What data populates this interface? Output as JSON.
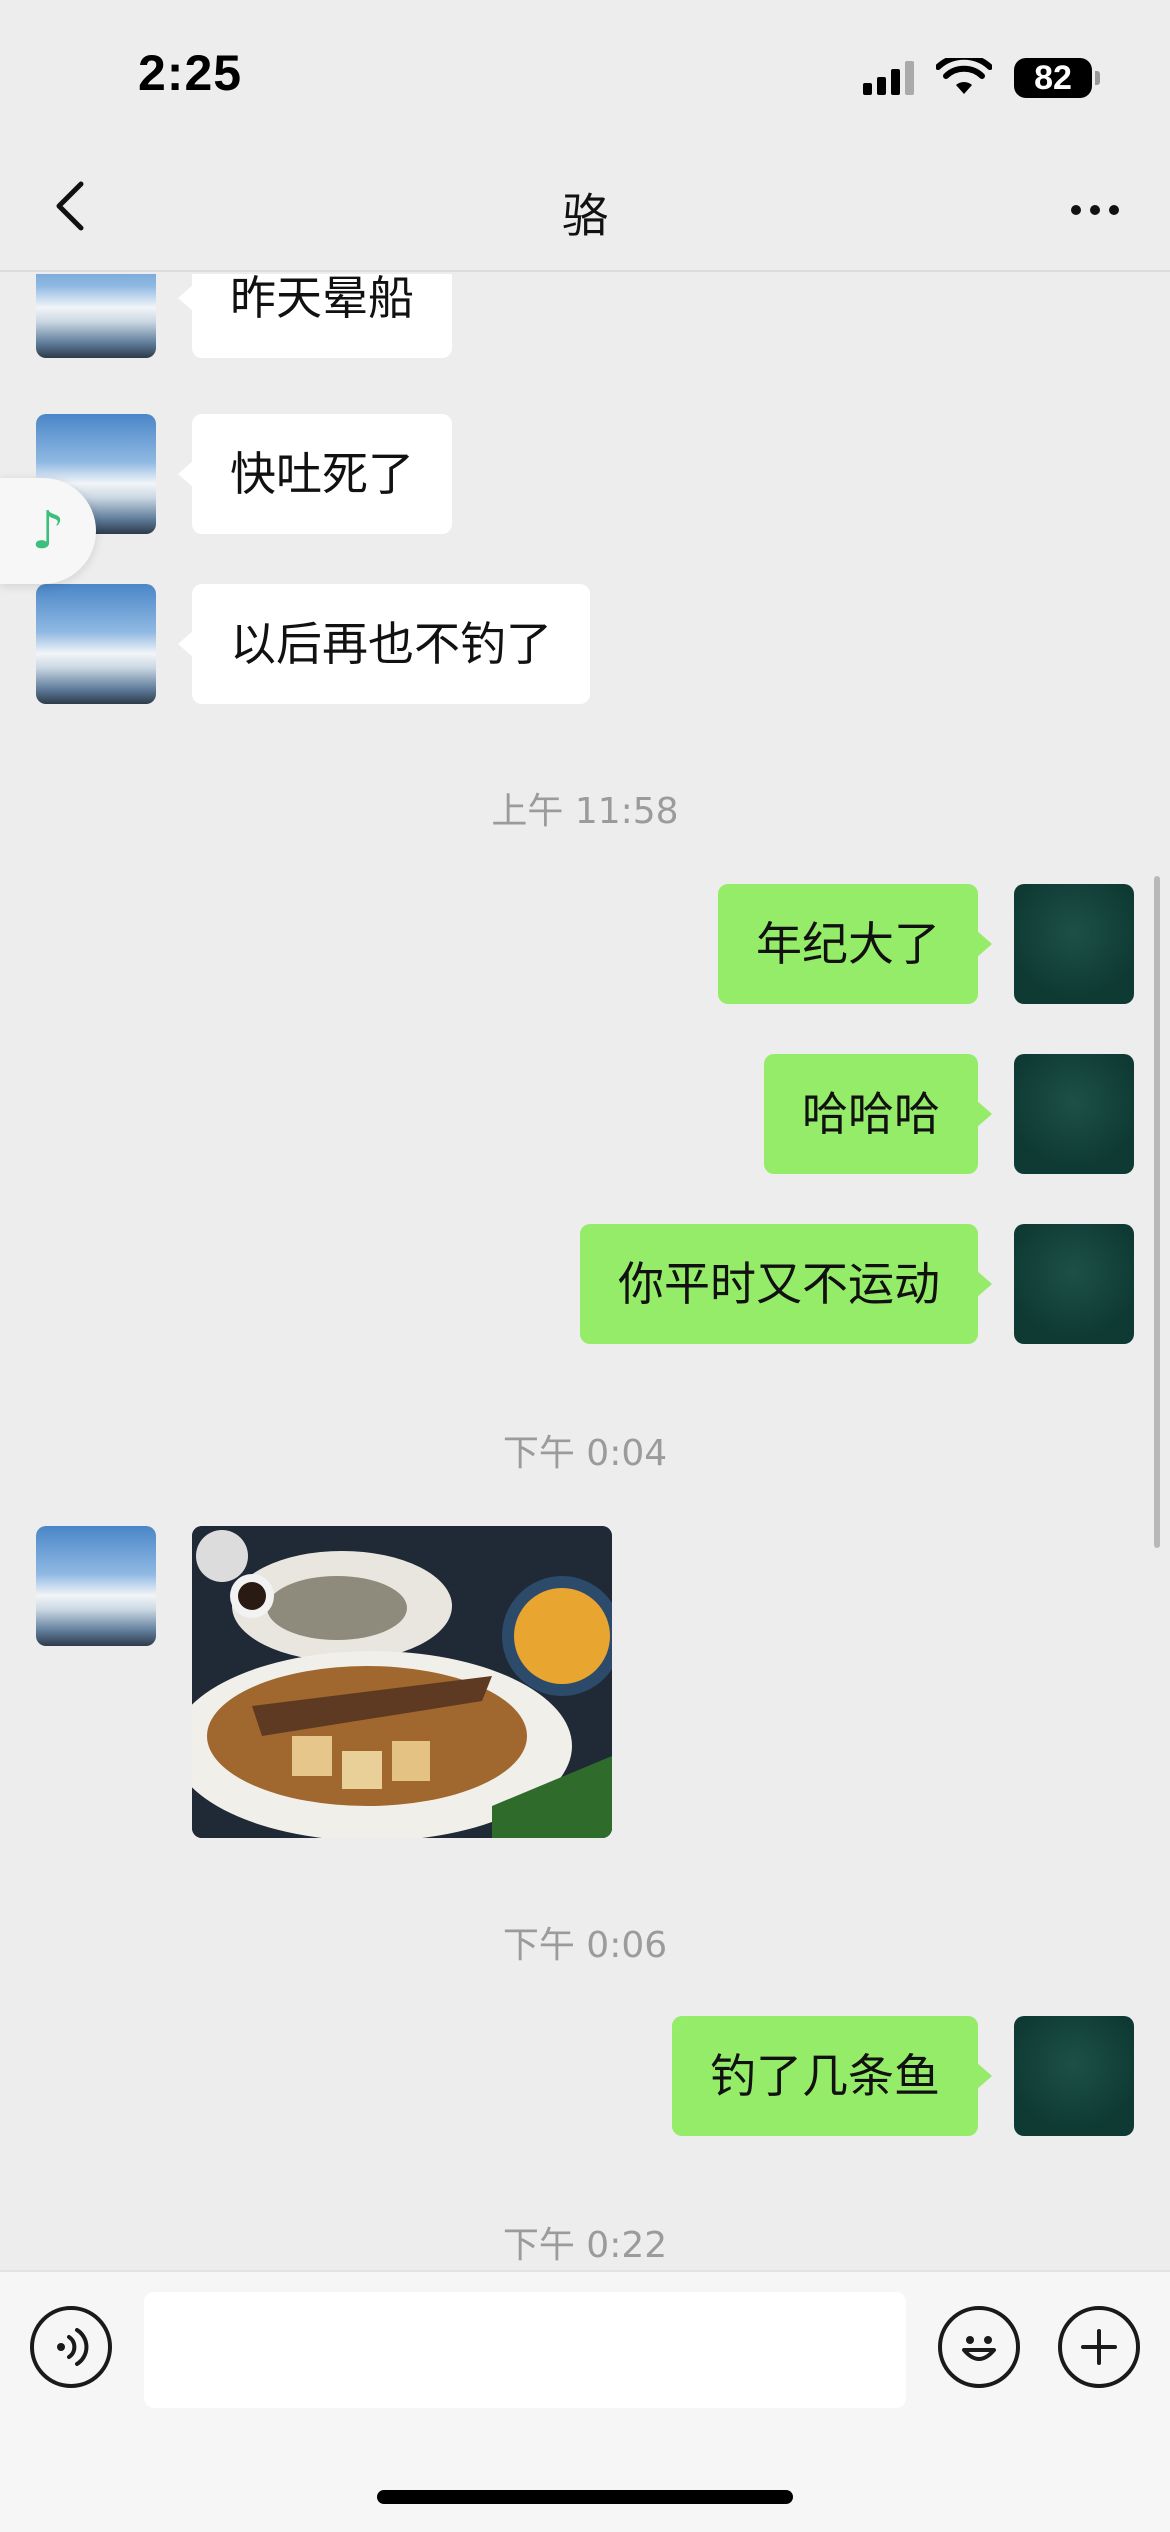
{
  "status_bar": {
    "time": "2:25",
    "battery": "82"
  },
  "header": {
    "title": "骆"
  },
  "messages": {
    "m1": "昨天晕船",
    "m2": "快吐死了",
    "m3": "以后再也不钓了",
    "t1": "上午 11:58",
    "m4": "年纪大了",
    "m5": "哈哈哈",
    "m6": "你平时又不运动",
    "t2": "下午 0:04",
    "t3": "下午 0:06",
    "m7": "钓了几条鱼",
    "t4": "下午 0:22"
  },
  "floating": {
    "icon": "music-note-icon",
    "glyph": "♪"
  },
  "input_bar": {
    "value": ""
  },
  "colors": {
    "self_bubble": "#95ec69",
    "other_bubble": "#ffffff",
    "background": "#ededed"
  }
}
